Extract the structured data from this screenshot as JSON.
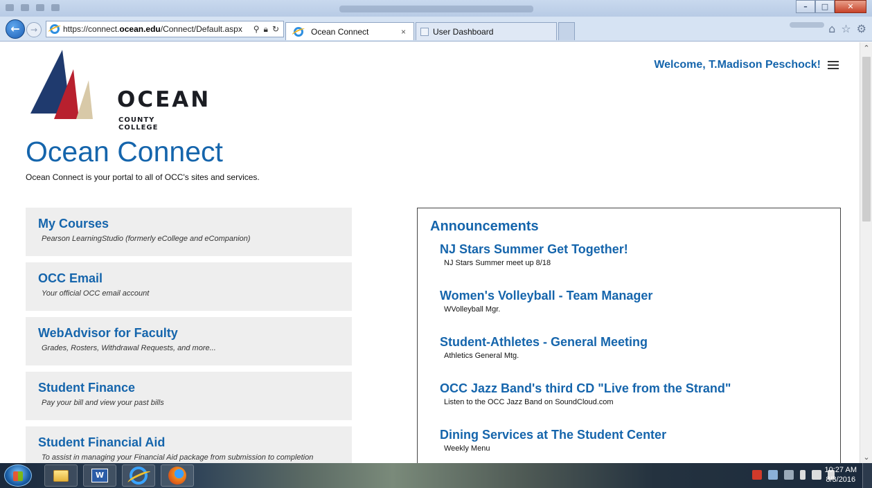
{
  "browser": {
    "url_prefix": "https://connect.",
    "url_domain": "ocean.edu",
    "url_suffix": "/Connect/Default.aspx",
    "tabs": [
      {
        "label": "Ocean Connect",
        "active": true
      },
      {
        "label": "User Dashboard",
        "active": false
      }
    ],
    "close_glyph": "×"
  },
  "header": {
    "logo_name": "OCEAN",
    "logo_sub": "COUNTY COLLEGE",
    "welcome": "Welcome, T.Madison Peschock!"
  },
  "page": {
    "title": "Ocean Connect",
    "subtitle": "Ocean Connect is your portal to all of OCC's sites and services."
  },
  "links": [
    {
      "title": "My Courses",
      "desc": "Pearson LearningStudio (formerly eCollege and eCompanion)"
    },
    {
      "title": "OCC Email",
      "desc": "Your official OCC email account"
    },
    {
      "title": "WebAdvisor for Faculty",
      "desc": "Grades, Rosters, Withdrawal Requests, and more..."
    },
    {
      "title": "Student Finance",
      "desc": "Pay your bill and view your past bills"
    },
    {
      "title": "Student Financial Aid",
      "desc": "To assist in managing your Financial Aid package from submission to completion"
    }
  ],
  "announcements": {
    "heading": "Announcements",
    "items": [
      {
        "title": "NJ Stars Summer Get Together!",
        "desc": "NJ Stars Summer meet up 8/18"
      },
      {
        "title": "Women's Volleyball - Team Manager",
        "desc": "WVolleyball Mgr."
      },
      {
        "title": "Student-Athletes - General Meeting",
        "desc": "Athletics General Mtg."
      },
      {
        "title": "OCC Jazz Band's third CD \"Live from the Strand\"",
        "desc": "Listen to the OCC Jazz Band on SoundCloud.com"
      },
      {
        "title": "Dining Services at The Student Center",
        "desc": "Weekly Menu"
      }
    ]
  },
  "taskbar": {
    "time": "10:27 AM",
    "date": "8/3/2016",
    "word_label": "W"
  },
  "colors": {
    "link_blue": "#1565ac",
    "card_gray": "#eeeeee",
    "logo_navy": "#1f3a6e",
    "logo_red": "#b8202e",
    "logo_tan": "#d8c9a8"
  }
}
